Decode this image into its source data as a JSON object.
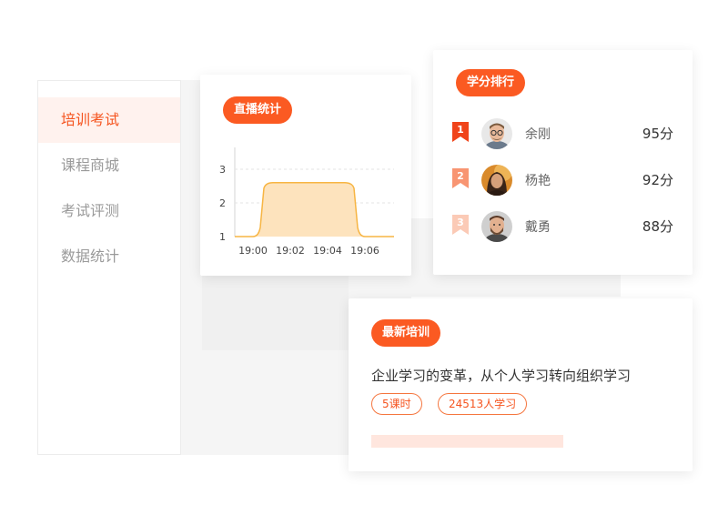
{
  "sidebar": {
    "items": [
      {
        "label": "培训考试",
        "active": true
      },
      {
        "label": "课程商城",
        "active": false
      },
      {
        "label": "考试评测",
        "active": false
      },
      {
        "label": "数据统计",
        "active": false
      }
    ]
  },
  "live_card": {
    "badge": "直播统计"
  },
  "chart_data": {
    "type": "area",
    "x": [
      "19:00",
      "19:01",
      "19:02",
      "19:03",
      "19:04",
      "19:05",
      "19:06"
    ],
    "x_ticks": [
      "19:00",
      "19:02",
      "19:04",
      "19:06"
    ],
    "y_ticks": [
      "1",
      "2",
      "3"
    ],
    "values": [
      1,
      2.6,
      2.6,
      2.6,
      2.6,
      2.6,
      1
    ],
    "ylim": [
      1,
      3
    ],
    "grid": "horizontal dashed",
    "colors": {
      "line": "#f7b543",
      "fill": "#fde3bd"
    }
  },
  "ranking_card": {
    "badge": "学分排行",
    "rows": [
      {
        "rank": "1",
        "name": "余刚",
        "score": "95分",
        "badge_color": "#f0441a",
        "avatar": "avatar-man-glasses-icon"
      },
      {
        "rank": "2",
        "name": "杨艳",
        "score": "92分",
        "badge_color": "#f89572",
        "avatar": "avatar-woman-icon"
      },
      {
        "rank": "3",
        "name": "戴勇",
        "score": "88分",
        "badge_color": "#fbcab6",
        "avatar": "avatar-man-beard-icon"
      }
    ]
  },
  "training_card": {
    "badge": "最新培训",
    "title": "企业学习的变革，从个人学习转向组织学习",
    "tags": [
      "5课时",
      "24513人学习"
    ],
    "progress": 1.0
  },
  "colors": {
    "accent": "#fb5a22"
  }
}
